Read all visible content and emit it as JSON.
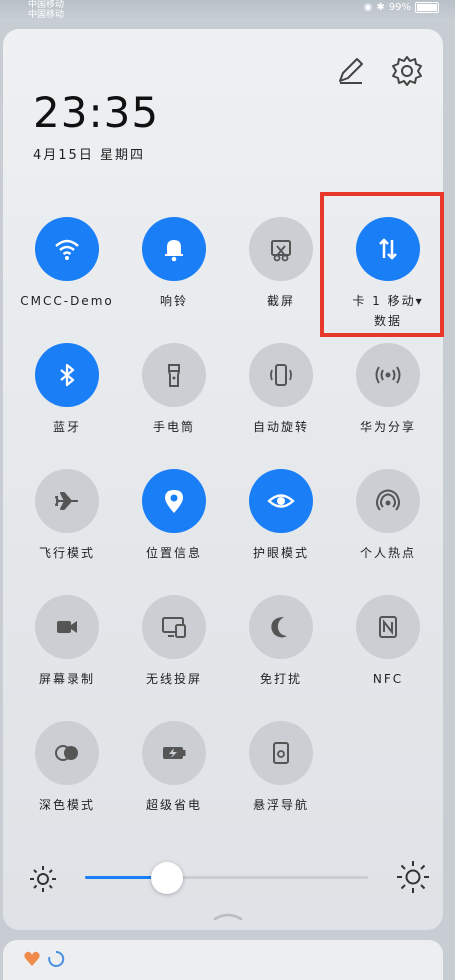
{
  "status_bar": {
    "carrier_line_1": "中国移动",
    "carrier_line_2": "中国移动",
    "battery_percent": "99%"
  },
  "header": {
    "time": "23:35",
    "date": "4月15日 星期四"
  },
  "tiles": [
    {
      "id": "wifi",
      "label": "CMCC-Demo",
      "active": true,
      "icon": "wifi-icon"
    },
    {
      "id": "ring",
      "label": "响铃",
      "active": true,
      "icon": "bell-icon"
    },
    {
      "id": "screenshot",
      "label": "截屏",
      "active": false,
      "icon": "screenshot-icon"
    },
    {
      "id": "mobile-data",
      "label": "卡 1 移动▾\n数据",
      "active": true,
      "icon": "data-arrows-icon"
    },
    {
      "id": "bluetooth",
      "label": "蓝牙",
      "active": true,
      "icon": "bluetooth-icon"
    },
    {
      "id": "flashlight",
      "label": "手电筒",
      "active": false,
      "icon": "flashlight-icon"
    },
    {
      "id": "auto-rotate",
      "label": "自动旋转",
      "active": false,
      "icon": "rotate-icon"
    },
    {
      "id": "huawei-share",
      "label": "华为分享",
      "active": false,
      "icon": "share-icon"
    },
    {
      "id": "airplane",
      "label": "飞行模式",
      "active": false,
      "icon": "airplane-icon"
    },
    {
      "id": "location",
      "label": "位置信息",
      "active": true,
      "icon": "location-pin-icon"
    },
    {
      "id": "eye-comfort",
      "label": "护眼模式",
      "active": true,
      "icon": "eye-icon"
    },
    {
      "id": "hotspot",
      "label": "个人热点",
      "active": false,
      "icon": "hotspot-icon"
    },
    {
      "id": "screen-record",
      "label": "屏幕录制",
      "active": false,
      "icon": "video-camera-icon"
    },
    {
      "id": "wireless-projection",
      "label": "无线投屏",
      "active": false,
      "icon": "projection-icon"
    },
    {
      "id": "do-not-disturb",
      "label": "免打扰",
      "active": false,
      "icon": "moon-icon"
    },
    {
      "id": "nfc",
      "label": "NFC",
      "active": false,
      "icon": "nfc-icon"
    },
    {
      "id": "dark-mode",
      "label": "深色模式",
      "active": false,
      "icon": "dark-mode-icon"
    },
    {
      "id": "power-saving",
      "label": "超级省电",
      "active": false,
      "icon": "battery-bolt-icon"
    },
    {
      "id": "floating-nav",
      "label": "悬浮导航",
      "active": false,
      "icon": "floating-nav-icon"
    }
  ],
  "brightness": {
    "level_fraction": 0.29
  },
  "colors": {
    "accent": "#1a7ef7",
    "inactive": "#cbced2",
    "highlight_box": "#e8382c"
  }
}
